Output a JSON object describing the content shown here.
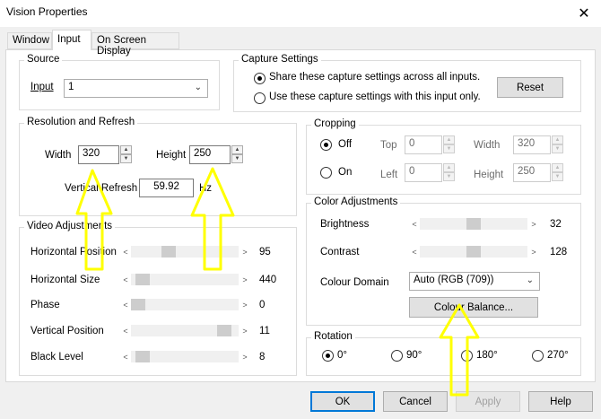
{
  "window": {
    "title": "Vision Properties",
    "close_glyph": "✕"
  },
  "tabs": [
    {
      "label": "Window",
      "active": false
    },
    {
      "label": "Input",
      "active": true
    },
    {
      "label": "On Screen Display",
      "active": false
    }
  ],
  "source": {
    "legend": "Source",
    "input_label": "Input",
    "input_value": "1"
  },
  "capture": {
    "legend": "Capture Settings",
    "option_share": "Share these capture settings across all inputs.",
    "option_this": "Use these capture settings with this input only.",
    "selected": "share",
    "reset_label": "Reset"
  },
  "resolution": {
    "legend": "Resolution and Refresh",
    "width_label": "Width",
    "width_value": "320",
    "height_label": "Height",
    "height_value": "250",
    "vrefresh_label": "Vertical Refresh",
    "vrefresh_value": "59.92",
    "vrefresh_unit": "Hz"
  },
  "cropping": {
    "legend": "Cropping",
    "off_label": "Off",
    "on_label": "On",
    "selected": "off",
    "top_label": "Top",
    "top_value": "0",
    "left_label": "Left",
    "left_value": "0",
    "width_label": "Width",
    "width_value": "320",
    "height_label": "Height",
    "height_value": "250"
  },
  "video": {
    "legend": "Video Adjustments",
    "sliders": [
      {
        "label": "Horizontal Position",
        "value": "95",
        "level": 0.33
      },
      {
        "label": "Horizontal Size",
        "value": "440",
        "level": 0.05
      },
      {
        "label": "Phase",
        "value": "0",
        "level": 0.0
      },
      {
        "label": "Vertical Position",
        "value": "11",
        "level": 0.92
      },
      {
        "label": "Black Level",
        "value": "8",
        "level": 0.05
      }
    ]
  },
  "color": {
    "legend": "Color Adjustments",
    "brightness_label": "Brightness",
    "brightness_value": "32",
    "brightness_level": 0.5,
    "contrast_label": "Contrast",
    "contrast_value": "128",
    "contrast_level": 0.5,
    "domain_label": "Colour Domain",
    "domain_value": "Auto (RGB (709))",
    "balance_label": "Colour Balance..."
  },
  "rotation": {
    "legend": "Rotation",
    "options": [
      "0°",
      "90°",
      "180°",
      "270°"
    ],
    "selected": "0°"
  },
  "footer": {
    "ok": "OK",
    "cancel": "Cancel",
    "apply": "Apply",
    "help": "Help"
  },
  "annotation_color": "#ffff00"
}
